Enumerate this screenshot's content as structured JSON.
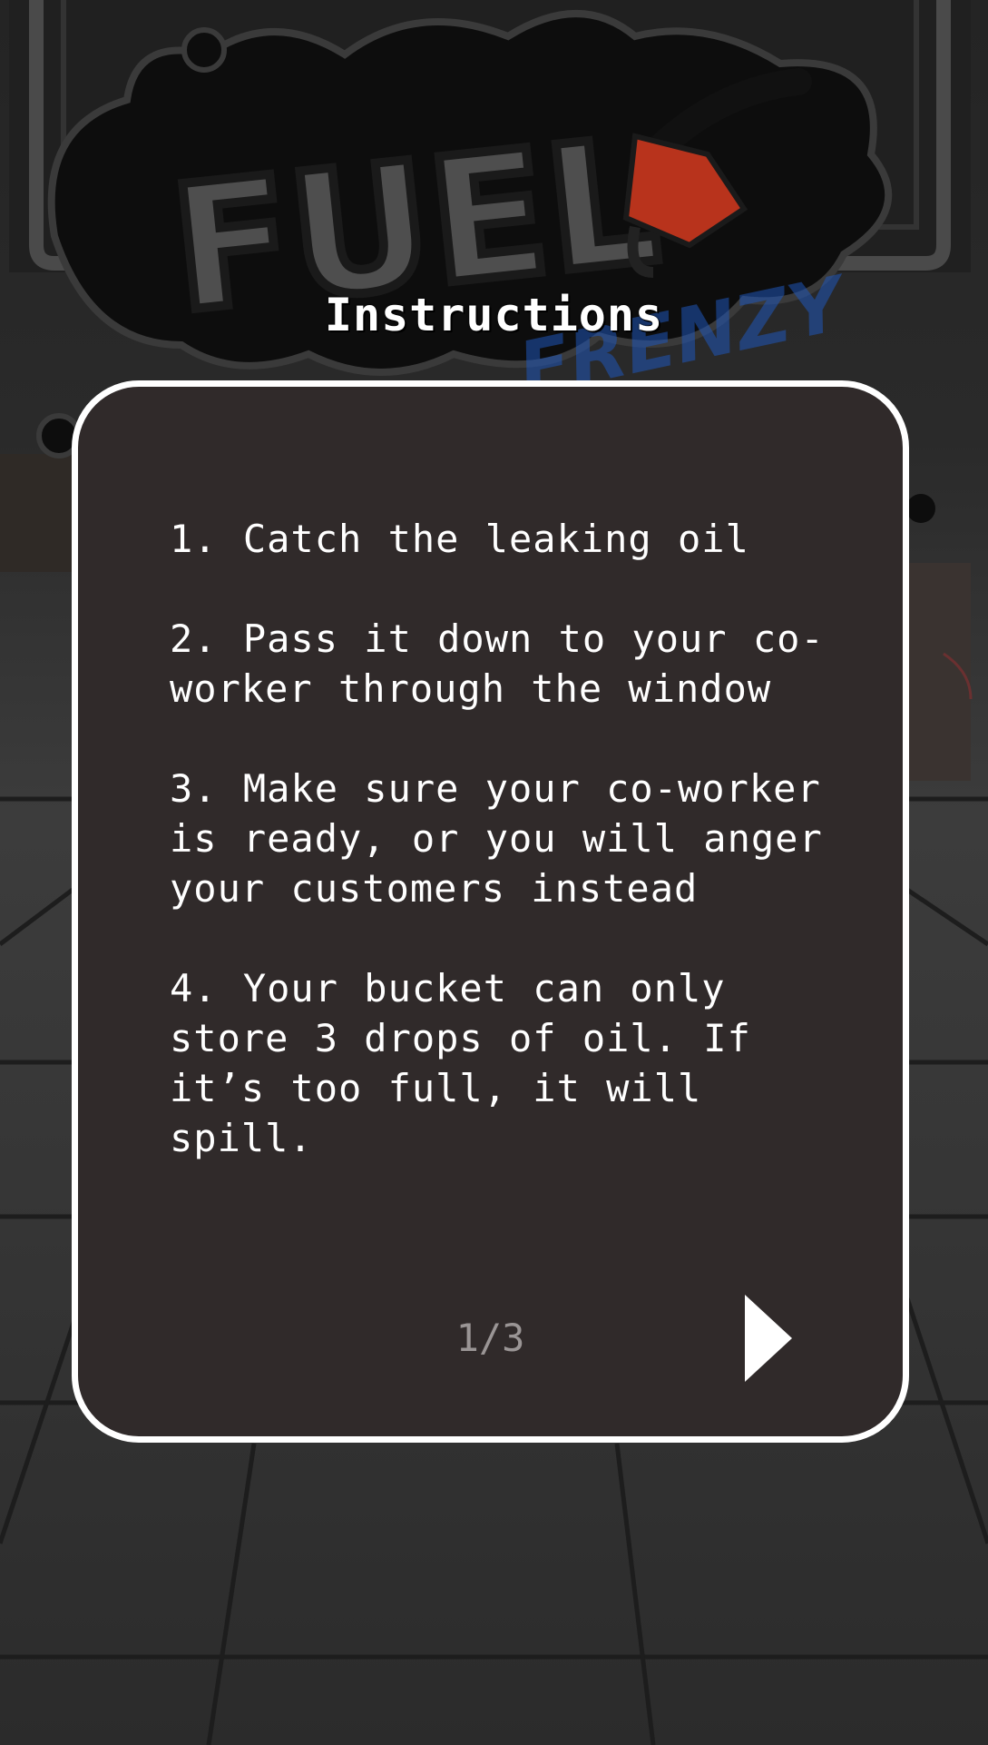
{
  "logo": {
    "word": "FUEL",
    "subword": "FRENZY"
  },
  "screen": {
    "title": "Instructions"
  },
  "instructions": [
    "1. Catch the leaking oil",
    "2. Pass it down to your co-worker through the window",
    "3. Make sure your co-worker is ready, or you will anger your customers instead",
    "4. Your bucket can only store 3 drops of oil. If it’s too full, it will spill."
  ],
  "pager": {
    "label": "1/3",
    "current": 1,
    "total": 3
  },
  "icons": {
    "next": "play-arrow-icon",
    "logo_nozzle": "fuel-nozzle-icon"
  },
  "colors": {
    "panel_bg": "#302a2a",
    "panel_border": "#ffffff",
    "text": "#ffffff",
    "pager_text": "#9a9595",
    "nozzle_red": "#b8331c",
    "logo_blue": "#1f55b8"
  }
}
